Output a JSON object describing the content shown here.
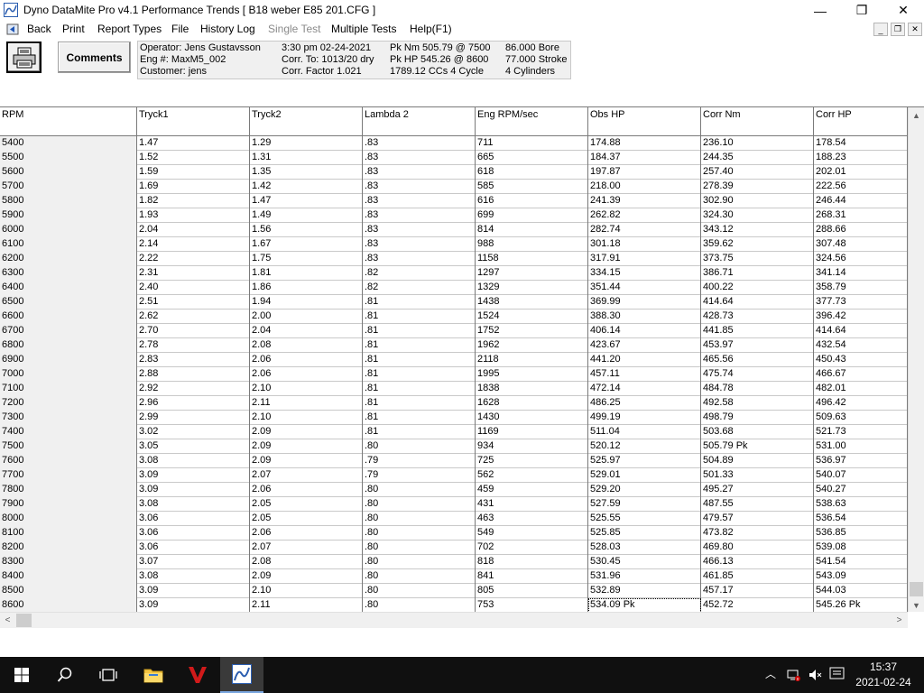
{
  "window": {
    "title": "Dyno DataMite Pro v4.1   Performance Trends   [ B18 weber E85 201.CFG ]",
    "minimize": "—",
    "maximize": "❐",
    "close": "✕"
  },
  "menu": {
    "back": "Back",
    "print": "Print",
    "report_types": "Report Types",
    "file": "File",
    "history_log": "History Log",
    "single_test": "Single Test",
    "multiple_tests": "Multiple Tests",
    "help": "Help(F1)",
    "mdi_min": "_",
    "mdi_restore": "❐",
    "mdi_close": "✕"
  },
  "toolbar": {
    "comments_label": "Comments"
  },
  "info": {
    "operator": "Operator: Jens Gustavsson",
    "eng": "Eng #: MaxM5_002",
    "customer": "Customer: jens",
    "time": "3:30 pm 02-24-2021",
    "corr_to": "Corr. To: 1013/20 dry",
    "corr_factor": "Corr. Factor 1.021",
    "pk_nm": "Pk Nm 505.79 @ 7500",
    "pk_hp": "Pk HP 545.26 @ 8600",
    "ccs": "1789.12 CCs  4 Cycle",
    "bore": "86.000 Bore",
    "stroke": "77.000 Stroke",
    "cylinders": "4 Cylinders"
  },
  "table": {
    "columns": [
      "RPM",
      "Tryck1",
      "Tryck2",
      "Lambda 2",
      "Eng RPM/sec",
      "Obs HP",
      "Corr Nm",
      "Corr HP"
    ],
    "rows": [
      [
        "5400",
        "1.47",
        "1.29",
        ".83",
        "711",
        "174.88",
        "236.10",
        "178.54"
      ],
      [
        "5500",
        "1.52",
        "1.31",
        ".83",
        "665",
        "184.37",
        "244.35",
        "188.23"
      ],
      [
        "5600",
        "1.59",
        "1.35",
        ".83",
        "618",
        "197.87",
        "257.40",
        "202.01"
      ],
      [
        "5700",
        "1.69",
        "1.42",
        ".83",
        "585",
        "218.00",
        "278.39",
        "222.56"
      ],
      [
        "5800",
        "1.82",
        "1.47",
        ".83",
        "616",
        "241.39",
        "302.90",
        "246.44"
      ],
      [
        "5900",
        "1.93",
        "1.49",
        ".83",
        "699",
        "262.82",
        "324.30",
        "268.31"
      ],
      [
        "6000",
        "2.04",
        "1.56",
        ".83",
        "814",
        "282.74",
        "343.12",
        "288.66"
      ],
      [
        "6100",
        "2.14",
        "1.67",
        ".83",
        "988",
        "301.18",
        "359.62",
        "307.48"
      ],
      [
        "6200",
        "2.22",
        "1.75",
        ".83",
        "1158",
        "317.91",
        "373.75",
        "324.56"
      ],
      [
        "6300",
        "2.31",
        "1.81",
        ".82",
        "1297",
        "334.15",
        "386.71",
        "341.14"
      ],
      [
        "6400",
        "2.40",
        "1.86",
        ".82",
        "1329",
        "351.44",
        "400.22",
        "358.79"
      ],
      [
        "6500",
        "2.51",
        "1.94",
        ".81",
        "1438",
        "369.99",
        "414.64",
        "377.73"
      ],
      [
        "6600",
        "2.62",
        "2.00",
        ".81",
        "1524",
        "388.30",
        "428.73",
        "396.42"
      ],
      [
        "6700",
        "2.70",
        "2.04",
        ".81",
        "1752",
        "406.14",
        "441.85",
        "414.64"
      ],
      [
        "6800",
        "2.78",
        "2.08",
        ".81",
        "1962",
        "423.67",
        "453.97",
        "432.54"
      ],
      [
        "6900",
        "2.83",
        "2.06",
        ".81",
        "2118",
        "441.20",
        "465.56",
        "450.43"
      ],
      [
        "7000",
        "2.88",
        "2.06",
        ".81",
        "1995",
        "457.11",
        "475.74",
        "466.67"
      ],
      [
        "7100",
        "2.92",
        "2.10",
        ".81",
        "1838",
        "472.14",
        "484.78",
        "482.01"
      ],
      [
        "7200",
        "2.96",
        "2.11",
        ".81",
        "1628",
        "486.25",
        "492.58",
        "496.42"
      ],
      [
        "7300",
        "2.99",
        "2.10",
        ".81",
        "1430",
        "499.19",
        "498.79",
        "509.63"
      ],
      [
        "7400",
        "3.02",
        "2.09",
        ".81",
        "1169",
        "511.04",
        "503.68",
        "521.73"
      ],
      [
        "7500",
        "3.05",
        "2.09",
        ".80",
        "934",
        "520.12",
        "505.79 Pk",
        "531.00"
      ],
      [
        "7600",
        "3.08",
        "2.09",
        ".79",
        "725",
        "525.97",
        "504.89",
        "536.97"
      ],
      [
        "7700",
        "3.09",
        "2.07",
        ".79",
        "562",
        "529.01",
        "501.33",
        "540.07"
      ],
      [
        "7800",
        "3.09",
        "2.06",
        ".80",
        "459",
        "529.20",
        "495.27",
        "540.27"
      ],
      [
        "7900",
        "3.08",
        "2.05",
        ".80",
        "431",
        "527.59",
        "487.55",
        "538.63"
      ],
      [
        "8000",
        "3.06",
        "2.05",
        ".80",
        "463",
        "525.55",
        "479.57",
        "536.54"
      ],
      [
        "8100",
        "3.06",
        "2.06",
        ".80",
        "549",
        "525.85",
        "473.82",
        "536.85"
      ],
      [
        "8200",
        "3.06",
        "2.07",
        ".80",
        "702",
        "528.03",
        "469.80",
        "539.08"
      ],
      [
        "8300",
        "3.07",
        "2.08",
        ".80",
        "818",
        "530.45",
        "466.13",
        "541.54"
      ],
      [
        "8400",
        "3.08",
        "2.09",
        ".80",
        "841",
        "531.96",
        "461.85",
        "543.09"
      ],
      [
        "8500",
        "3.09",
        "2.10",
        ".80",
        "805",
        "532.89",
        "457.17",
        "544.03"
      ],
      [
        "8600",
        "3.09",
        "2.11",
        ".80",
        "753",
        "534.09 Pk",
        "452.72",
        "545.26 Pk"
      ]
    ]
  },
  "taskbar": {
    "clock_time": "15:37",
    "clock_date": "2021-02-24"
  }
}
